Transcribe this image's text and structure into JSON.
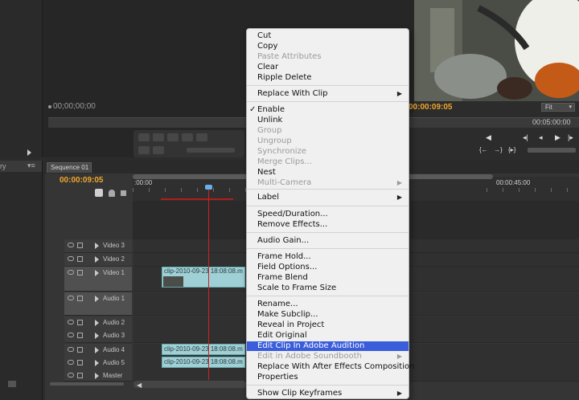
{
  "source_monitor": {
    "timecode": "00;00;00;00"
  },
  "program_monitor": {
    "timecode": "00:00:09:05",
    "fit_label": "Fit",
    "end_timecode": "00:05:00:00"
  },
  "left_panel": {
    "tab_fragment": "ry"
  },
  "sequence": {
    "tab_label": "Sequence 01",
    "timecode": "00:00:09:05",
    "ruler_labels": [
      ":00:00",
      "00:00:45:00"
    ],
    "tracks": [
      {
        "label": "Video 3"
      },
      {
        "label": "Video 2"
      },
      {
        "label": "Video 1"
      },
      {
        "label": "Audio 1"
      },
      {
        "label": "Audio 2"
      },
      {
        "label": "Audio 3"
      },
      {
        "label": "Audio 4"
      },
      {
        "label": "Audio 5"
      },
      {
        "label": "Master"
      }
    ],
    "clips": {
      "video1": "clip-2010-09-23 18:08:08.m",
      "audio4": "clip-2010-09-23 18:08:08.m",
      "audio5": "clip-2010-09-23 18:08:08.m"
    }
  },
  "context_menu": {
    "items": [
      {
        "label": "Cut",
        "disabled": false
      },
      {
        "label": "Copy",
        "disabled": false
      },
      {
        "label": "Paste Attributes",
        "disabled": true
      },
      {
        "label": "Clear",
        "disabled": false
      },
      {
        "label": "Ripple Delete",
        "disabled": false
      },
      {
        "label": "Replace With Clip",
        "disabled": false,
        "submenu": true
      },
      {
        "label": "Enable",
        "disabled": false,
        "checked": true
      },
      {
        "label": "Unlink",
        "disabled": false
      },
      {
        "label": "Group",
        "disabled": true
      },
      {
        "label": "Ungroup",
        "disabled": true
      },
      {
        "label": "Synchronize",
        "disabled": true
      },
      {
        "label": "Merge Clips...",
        "disabled": true
      },
      {
        "label": "Nest",
        "disabled": false
      },
      {
        "label": "Multi-Camera",
        "disabled": true,
        "submenu": true
      },
      {
        "label": "Label",
        "disabled": false,
        "submenu": true
      },
      {
        "label": "Speed/Duration...",
        "disabled": false
      },
      {
        "label": "Remove Effects...",
        "disabled": false
      },
      {
        "label": "Audio Gain...",
        "disabled": false
      },
      {
        "label": "Frame Hold...",
        "disabled": false
      },
      {
        "label": "Field Options...",
        "disabled": false
      },
      {
        "label": "Frame Blend",
        "disabled": false
      },
      {
        "label": "Scale to Frame Size",
        "disabled": false
      },
      {
        "label": "Rename...",
        "disabled": false
      },
      {
        "label": "Make Subclip...",
        "disabled": false
      },
      {
        "label": "Reveal in Project",
        "disabled": false
      },
      {
        "label": "Edit Original",
        "disabled": false
      },
      {
        "label": "Edit Clip In Adobe Audition",
        "disabled": false,
        "highlighted": true
      },
      {
        "label": "Edit in Adobe Soundbooth",
        "disabled": true,
        "submenu": true
      },
      {
        "label": "Replace With After Effects Composition",
        "disabled": false
      },
      {
        "label": "Properties",
        "disabled": false
      },
      {
        "label": "Show Clip Keyframes",
        "disabled": false,
        "submenu": true
      }
    ]
  },
  "colors": {
    "timecode_accent": "#f0a72c",
    "menu_highlight": "#3a5ddb",
    "clip_fill": "#9fd0d6",
    "playhead": "#d02020"
  }
}
